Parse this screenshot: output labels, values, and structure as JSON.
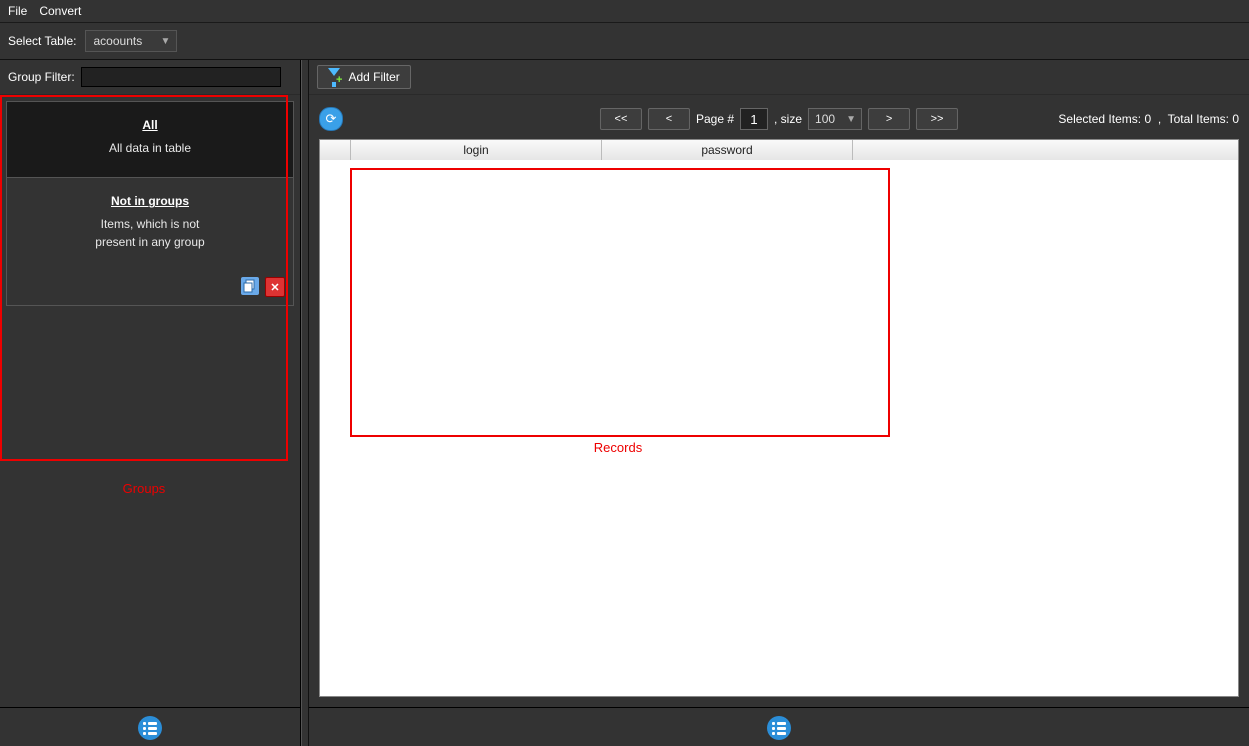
{
  "menubar": {
    "file": "File",
    "convert": "Convert"
  },
  "toolbar": {
    "select_table_label": "Select Table:",
    "selected_table": "acoounts"
  },
  "sidebar": {
    "group_filter_label": "Group Filter:",
    "group_filter_value": "",
    "groups": [
      {
        "title": "All",
        "desc": "All data in table"
      },
      {
        "title": "Not in groups",
        "desc_line1": "Items, which is not",
        "desc_line2": "present in any group"
      }
    ],
    "annotation": "Groups"
  },
  "filterbar": {
    "add_filter": "Add Filter"
  },
  "pager": {
    "first": "<<",
    "prev": "<",
    "page_label": "Page #",
    "page_value": "1",
    "size_label": ", size",
    "size_value": "100",
    "next": ">",
    "last": ">>"
  },
  "status": {
    "selected_label": "Selected Items:",
    "selected_value": "0",
    "sep": ",",
    "total_label": "Total Items:",
    "total_value": "0"
  },
  "table": {
    "col_login": "login",
    "col_password": "password"
  },
  "annotation_records": "Records"
}
